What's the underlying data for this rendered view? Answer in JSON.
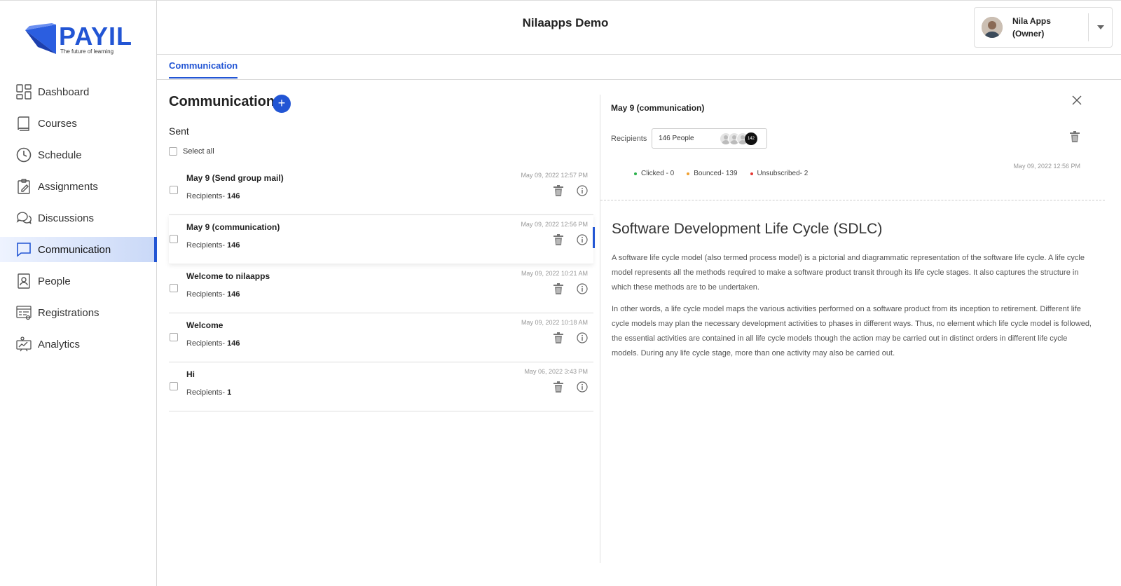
{
  "brand": {
    "name": "PAYIL",
    "tagline": "The future of learning",
    "color": "#2255d4"
  },
  "sidebar": {
    "items": [
      {
        "label": "Dashboard",
        "icon": "dashboard-icon"
      },
      {
        "label": "Courses",
        "icon": "book-icon"
      },
      {
        "label": "Schedule",
        "icon": "clock-icon"
      },
      {
        "label": "Assignments",
        "icon": "clipboard-icon"
      },
      {
        "label": "Discussions",
        "icon": "chat-bubbles-icon"
      },
      {
        "label": "Communication",
        "icon": "message-icon",
        "active": true
      },
      {
        "label": "People",
        "icon": "contact-book-icon"
      },
      {
        "label": "Registrations",
        "icon": "registration-form-icon"
      },
      {
        "label": "Analytics",
        "icon": "analytics-icon"
      }
    ]
  },
  "header": {
    "title": "Nilaapps Demo",
    "user_name": "Nila Apps",
    "user_role": "(Owner)"
  },
  "tabs": [
    {
      "label": "Communication",
      "active": true
    }
  ],
  "list": {
    "title": "Communication",
    "add_label": "+",
    "section": "Sent",
    "select_all": "Select all",
    "rows": [
      {
        "title": "May 9 (Send group mail)",
        "recipients_label": "Recipients- ",
        "recipients": "146",
        "date": "May 09, 2022 12:57 PM"
      },
      {
        "title": "May 9 (communication)",
        "recipients_label": "Recipients- ",
        "recipients": "146",
        "date": "May 09, 2022 12:56 PM",
        "active": true
      },
      {
        "title": "Welcome to nilaapps",
        "recipients_label": "Recipients- ",
        "recipients": "146",
        "date": "May 09, 2022 10:21 AM"
      },
      {
        "title": "Welcome",
        "recipients_label": "Recipients- ",
        "recipients": "146",
        "date": "May 09, 2022 10:18 AM"
      },
      {
        "title": "Hi",
        "recipients_label": "Recipients- ",
        "recipients": "1",
        "date": "May 06, 2022 3:43 PM"
      }
    ]
  },
  "detail": {
    "title": "May 9 (communication)",
    "recipients_label": "Recipients",
    "recipients_value": "146 People",
    "recipients_more": "142",
    "date": "May 09, 2022 12:56 PM",
    "stats": [
      {
        "label": "Clicked - 0",
        "color": "#2bb24c"
      },
      {
        "label": "Bounced- 139",
        "color": "#f0a030"
      },
      {
        "label": "Unsubscribed- 2",
        "color": "#e53935"
      }
    ],
    "heading": "Software Development Life Cycle (SDLC)",
    "para1": "A software life cycle model (also termed process model) is a pictorial and diagrammatic representation of the software life cycle. A life cycle model represents all the methods required to make a software product transit through its life cycle stages. It also captures the structure in which these methods are to be undertaken.",
    "para2": "In other words, a life cycle model maps the various activities performed on a software product from its inception to retirement. Different life cycle models may plan the necessary development activities to phases in different ways. Thus, no element which life cycle model is followed, the essential activities are contained in all life cycle models though the action may be carried out in distinct orders in different life cycle models. During any life cycle stage, more than one activity may also be carried out."
  }
}
